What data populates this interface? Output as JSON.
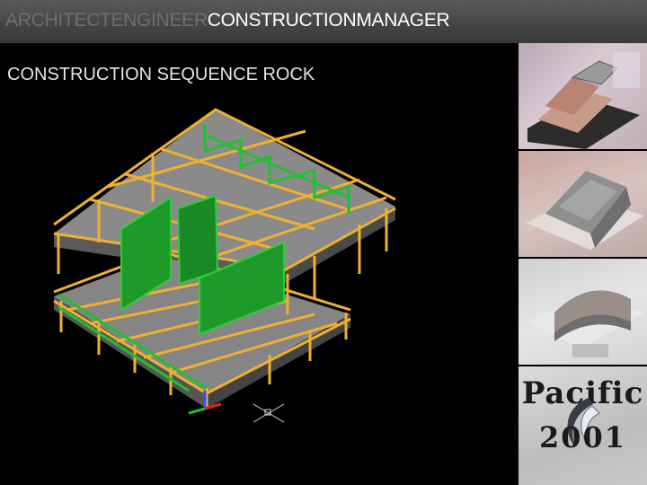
{
  "header": {
    "title_part1": "ARCHITECTENGINEER",
    "title_part2": "CONSTRUCTIONMANAGER"
  },
  "subtitle": "CONSTRUCTION SEQUENCE ROCK",
  "logo": {
    "top_word": "Pacific",
    "bottom_word": "2001"
  }
}
